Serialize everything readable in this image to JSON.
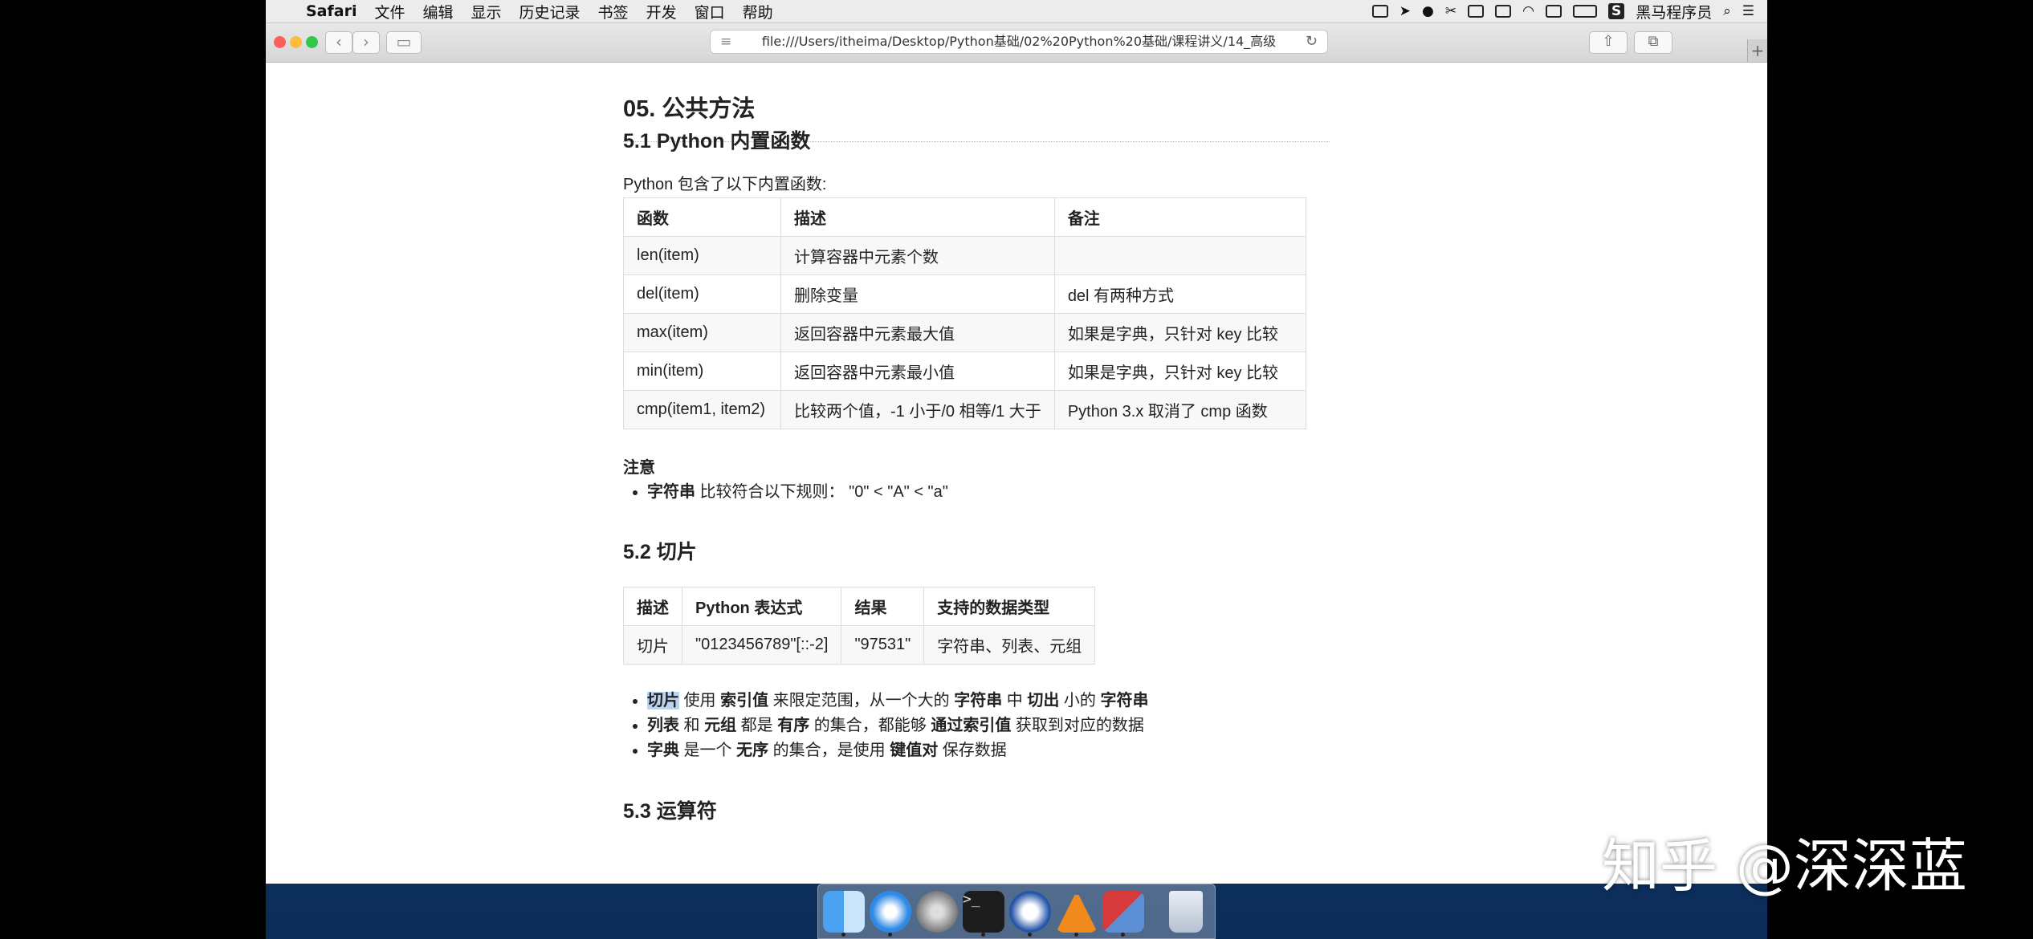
{
  "menubar": {
    "app": "Safari",
    "items": [
      "文件",
      "编辑",
      "显示",
      "历史记录",
      "书签",
      "开发",
      "窗口",
      "帮助"
    ],
    "right_app": "黑马程序员"
  },
  "browser": {
    "url": "file:///Users/itheima/Desktop/Python基础/02%20Python%20基础/课程讲义/14_高级"
  },
  "doc": {
    "h1": "05. 公共方法",
    "s51_title": "5.1 Python 内置函数",
    "s51_intro": "Python 包含了以下内置函数:",
    "t1_headers": [
      "函数",
      "描述",
      "备注"
    ],
    "t1_rows": [
      [
        "len(item)",
        "计算容器中元素个数",
        ""
      ],
      [
        "del(item)",
        "删除变量",
        "del 有两种方式"
      ],
      [
        "max(item)",
        "返回容器中元素最大值",
        "如果是字典，只针对 key 比较"
      ],
      [
        "min(item)",
        "返回容器中元素最小值",
        "如果是字典，只针对 key 比较"
      ],
      [
        "cmp(item1, item2)",
        "比较两个值，-1 小于/0 相等/1 大于",
        "Python 3.x 取消了 cmp 函数"
      ]
    ],
    "note_title": "注意",
    "note_bold": "字符串",
    "note_text": " 比较符合以下规则： \"0\" < \"A\" < \"a\"",
    "s52_title": "5.2 切片",
    "t2_headers": [
      "描述",
      "Python 表达式",
      "结果",
      "支持的数据类型"
    ],
    "t2_row": [
      "切片",
      "\"0123456789\"[::-2]",
      "\"97531\"",
      "字符串、列表、元组"
    ],
    "b1": [
      "切片",
      " 使用 ",
      "索引值",
      " 来限定范围，从一个大的 ",
      "字符串",
      " 中 ",
      "切出",
      " 小的 ",
      "字符串"
    ],
    "b2": [
      "列表",
      " 和 ",
      "元组",
      " 都是 ",
      "有序",
      " 的集合，都能够 ",
      "通过索引值",
      " 获取到对应的数据"
    ],
    "b3": [
      "字典",
      " 是一个 ",
      "无序",
      " 的集合，是使用 ",
      "键值对",
      " 保存数据"
    ],
    "s53_title": "5.3 运算符"
  },
  "watermark": {
    "top": "知乎",
    "bottom": "知乎 @深深蓝"
  },
  "dock": {
    "apps": [
      "finder-icon",
      "safari-icon",
      "launchpad-icon",
      "terminal-icon",
      "screenflow-icon",
      "vlc-icon",
      "parallels-icon",
      "trash-icon"
    ]
  },
  "colors": {
    "highlight": "#b9d3f3",
    "desktop": "#1f5d9c",
    "traffic": [
      "#fc605c",
      "#fdbc40",
      "#34c84a"
    ]
  }
}
